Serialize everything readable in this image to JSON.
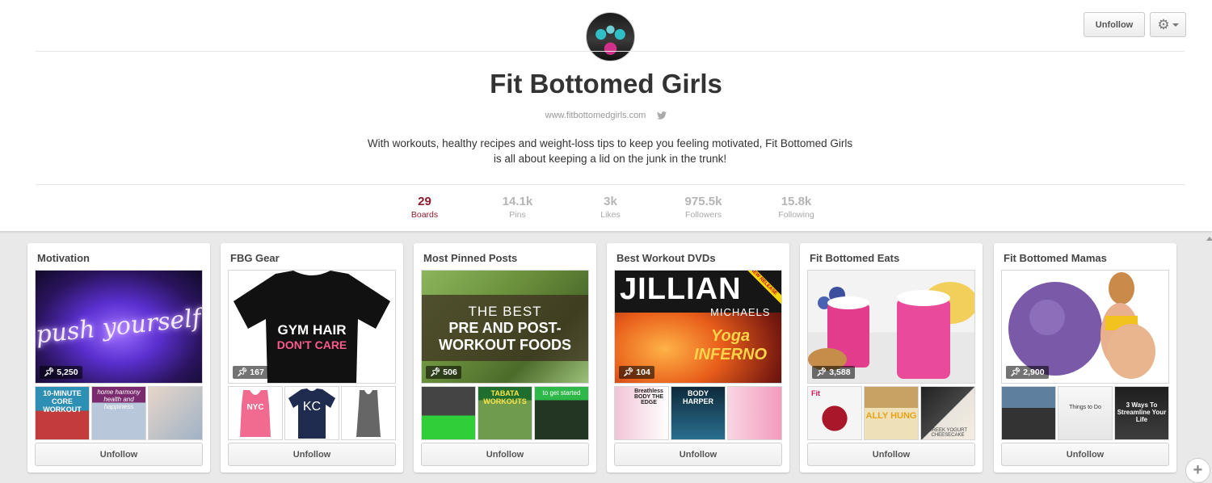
{
  "profile": {
    "name": "Fit Bottomed Girls",
    "website": "www.fitbottomedgirls.com",
    "bio": "With workouts, healthy recipes and weight-loss tips to keep you feeling motivated, Fit Bottomed Girls is all about keeping a lid on the junk in the trunk!",
    "unfollow_label": "Unfollow",
    "stats": [
      {
        "value": "29",
        "label": "Boards"
      },
      {
        "value": "14.1k",
        "label": "Pins"
      },
      {
        "value": "3k",
        "label": "Likes"
      },
      {
        "value": "975.5k",
        "label": "Followers"
      },
      {
        "value": "15.8k",
        "label": "Following"
      }
    ]
  },
  "boards": [
    {
      "title": "Motivation",
      "pins": "5,250",
      "unfollow_label": "Unfollow",
      "cover_text": "push yourself",
      "thumbs": [
        "10-MINUTE CORE WORKOUT",
        "home harmony health and happiness",
        ""
      ]
    },
    {
      "title": "FBG Gear",
      "pins": "167",
      "unfollow_label": "Unfollow",
      "cover_text_1": "GYM HAIR",
      "cover_text_2": "DON'T CARE",
      "thumbs": [
        "NYC",
        "KC",
        ""
      ]
    },
    {
      "title": "Most Pinned Posts",
      "pins": "506",
      "unfollow_label": "Unfollow",
      "cover_text_1": "THE BEST",
      "cover_text_2": "PRE AND POST-",
      "cover_text_3": "WORKOUT FOODS",
      "thumbs": [
        "",
        "TABATA WORKOUTS",
        "to get started"
      ]
    },
    {
      "title": "Best Workout DVDs",
      "pins": "104",
      "unfollow_label": "Unfollow",
      "cover_text_1": "JILLIAN",
      "cover_text_2": "MICHAELS",
      "cover_text_3": "Yoga INFERNO",
      "badge": "NEW RELEASE",
      "thumbs": [
        "Breathless BODY THE EDGE",
        "BODY HARPER",
        ""
      ]
    },
    {
      "title": "Fit Bottomed Eats",
      "pins": "3,588",
      "unfollow_label": "Unfollow",
      "thumbs": [
        "Fit",
        "ALLY HUNG",
        "GREEK YOGURT CHEESECAKE"
      ]
    },
    {
      "title": "Fit Bottomed Mamas",
      "pins": "2,900",
      "unfollow_label": "Unfollow",
      "thumbs": [
        "",
        "Things to Do",
        "3 Ways To Streamline Your Life"
      ]
    }
  ],
  "colors": {
    "accent": "#8e1b2e",
    "background": "#e9e9e9"
  }
}
